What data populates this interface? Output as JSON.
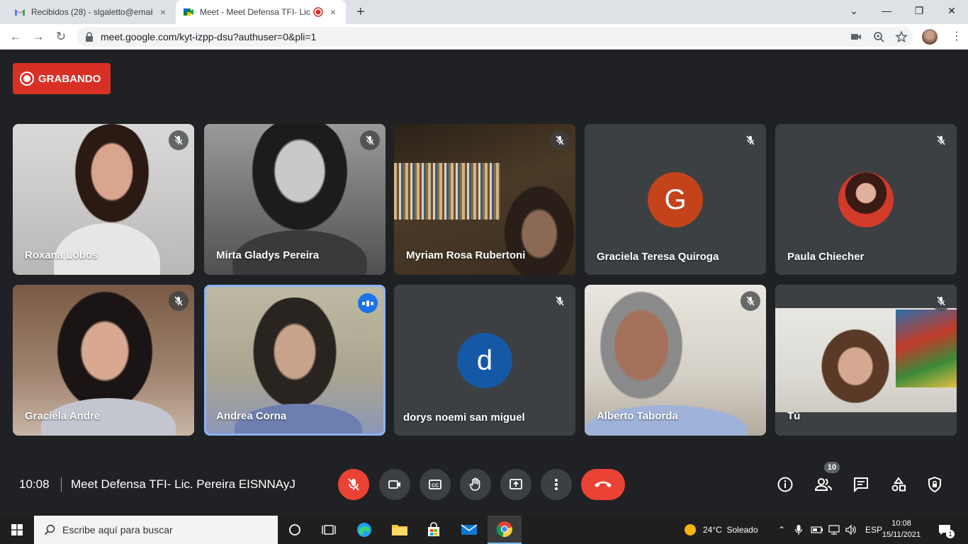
{
  "browser": {
    "tabs": [
      {
        "title": "Recibidos (28) - slgaletto@email.",
        "close": "×"
      },
      {
        "title": "Meet - Meet Defensa TFI- Lic",
        "close": "×"
      }
    ],
    "new_tab": "+",
    "window_controls": {
      "minimize": "—",
      "restore": "❐",
      "close": "✕"
    },
    "url": "meet.google.com/kyt-izpp-dsu?authuser=0&pli=1"
  },
  "meet": {
    "recording_label": "GRABANDO",
    "participants": [
      {
        "name": "Roxana Lobos",
        "muted": true,
        "video": true
      },
      {
        "name": "Mirta Gladys Pereira",
        "muted": true,
        "video": true
      },
      {
        "name": "Myriam Rosa Rubertoni",
        "muted": true,
        "video": true
      },
      {
        "name": "Graciela Teresa Quiroga",
        "muted": true,
        "video": false,
        "avatar_letter": "G",
        "avatar_color": "#c5431b"
      },
      {
        "name": "Paula Chiecher",
        "muted": true,
        "video": false,
        "avatar_photo": true
      },
      {
        "name": "Graciela Andre",
        "muted": true,
        "video": true
      },
      {
        "name": "Andrea Corna",
        "muted": false,
        "video": true,
        "speaking": true
      },
      {
        "name": "dorys noemi san miguel",
        "muted": true,
        "video": false,
        "avatar_letter": "d",
        "avatar_color": "#1558a6"
      },
      {
        "name": "Alberto Taborda",
        "muted": true,
        "video": true
      },
      {
        "name": "Tú",
        "muted": true,
        "video": true
      }
    ],
    "time": "10:08",
    "meeting_title": "Meet Defensa TFI- Lic. Pereira EISNNAyJ",
    "participant_count": "10",
    "controls": [
      "mic-off-icon",
      "camera-icon",
      "captions-icon",
      "raise-hand-icon",
      "present-icon",
      "more-icon",
      "hangup-icon"
    ],
    "right_controls": [
      "info-icon",
      "people-icon",
      "chat-icon",
      "activities-icon",
      "host-controls-icon"
    ]
  },
  "taskbar": {
    "search_placeholder": "Escribe aquí para buscar",
    "weather": "24°C  Soleado",
    "language": "ESP",
    "clock_time": "10:08",
    "clock_date": "15/11/2021",
    "notification_count": "1"
  },
  "colors": {
    "meet_bg": "#202124",
    "tile_bg": "#3c4043",
    "recording": "#d93025",
    "hangup": "#ea4335",
    "speaking_border": "#8ab4f8"
  }
}
